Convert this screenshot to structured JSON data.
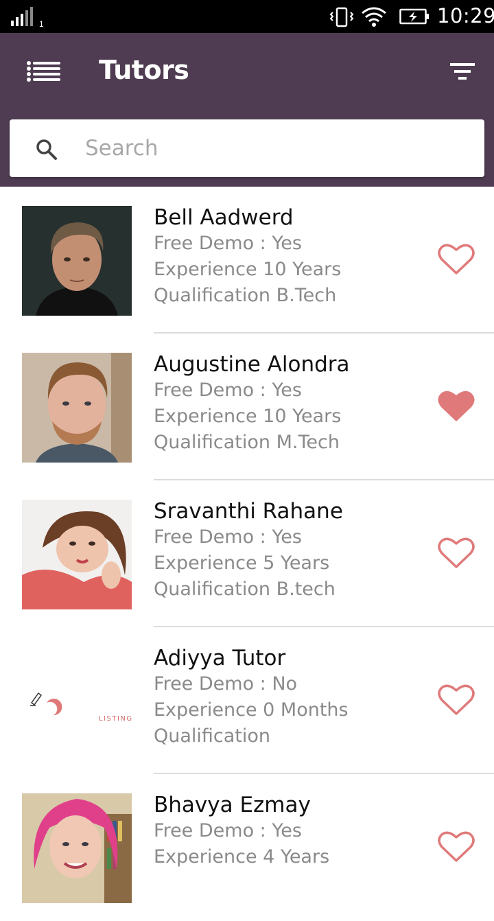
{
  "status_bar": {
    "time": "10:29",
    "sim": "1"
  },
  "app_bar": {
    "title": "Tutors"
  },
  "search": {
    "placeholder": "Search"
  },
  "tutors": [
    {
      "name": "Bell Aadwerd",
      "free_demo": "Free Demo : Yes",
      "experience": "Experience 10 Years",
      "qualification": "Qualification B.Tech",
      "favorite": false
    },
    {
      "name": "Augustine Alondra",
      "free_demo": "Free Demo : Yes",
      "experience": "Experience 10 Years",
      "qualification": "Qualification M.Tech",
      "favorite": true
    },
    {
      "name": "Sravanthi Rahane",
      "free_demo": "Free Demo : Yes",
      "experience": "Experience 5 Years",
      "qualification": "Qualification B.tech",
      "favorite": false
    },
    {
      "name": "Adiyya Tutor",
      "free_demo": "Free Demo : No",
      "experience": "Experience 0 Months",
      "qualification": "Qualification",
      "favorite": false,
      "logo_text": "LISTINGS"
    },
    {
      "name": "Bhavya Ezmay",
      "free_demo": "Free Demo : Yes",
      "experience": "Experience 4 Years",
      "qualification": "",
      "favorite": false
    }
  ],
  "colors": {
    "app_bar": "#4f3c52",
    "heart": "#e07a7a",
    "status_bar": "#000000"
  }
}
